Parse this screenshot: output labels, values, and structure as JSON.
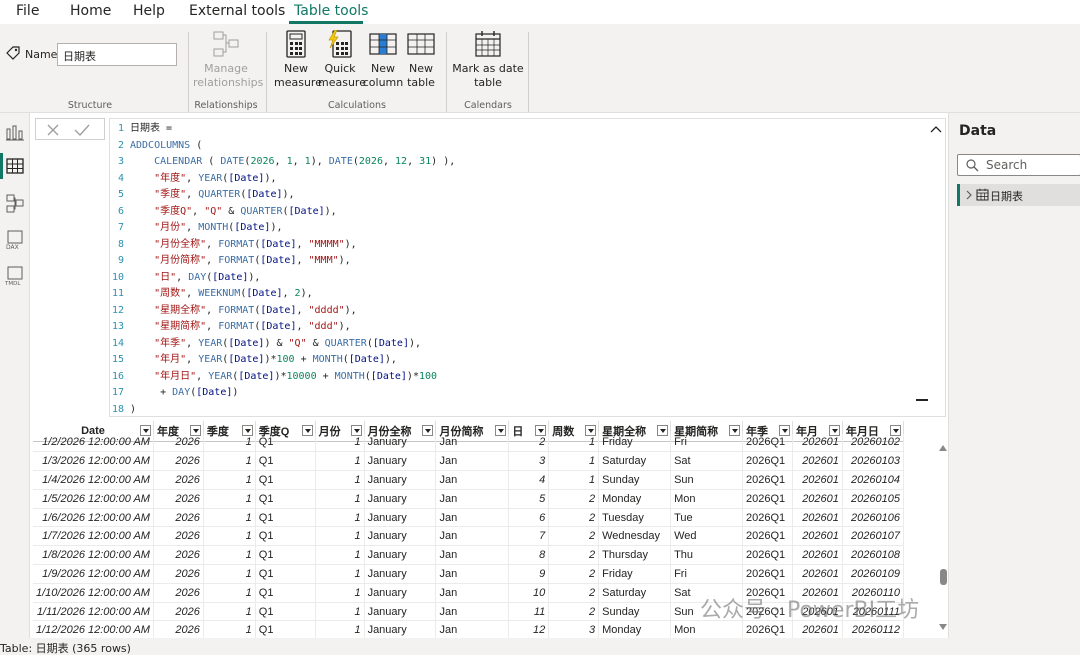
{
  "menu": {
    "file": "File",
    "home": "Home",
    "help": "Help",
    "external_tools": "External tools",
    "table_tools": "Table tools"
  },
  "ribbon": {
    "name_label": "Name",
    "name_value": "日期表",
    "structure_label": "Structure",
    "manage_relationships": "Manage relationships",
    "relationships_label": "Relationships",
    "new_measure": "New measure",
    "quick_measure": "Quick measure",
    "new_column": "New column",
    "new_table": "New table",
    "calculations_label": "Calculations",
    "mark_as_date_table": "Mark as date table",
    "calendars_label": "Calendars"
  },
  "editor": {
    "lines": [
      {
        "n": "1",
        "html": "日期表 ="
      },
      {
        "n": "2",
        "html": "<span class='kw'>ADDCOLUMNS</span> ("
      },
      {
        "n": "3",
        "html": "    <span class='kw'>CALENDAR</span> ( <span class='kw'>DATE</span>(<span class='num'>2026</span>, <span class='num'>1</span>, <span class='num'>1</span>), <span class='kw'>DATE</span>(<span class='num'>2026</span>, <span class='num'>12</span>, <span class='num'>31</span>) ),"
      },
      {
        "n": "4",
        "html": "    <span class='str'>\"年度\"</span>, <span class='kw'>YEAR</span>(<span class='col'>[Date]</span>),"
      },
      {
        "n": "5",
        "html": "    <span class='str'>\"季度\"</span>, <span class='kw'>QUARTER</span>(<span class='col'>[Date]</span>),"
      },
      {
        "n": "6",
        "html": "    <span class='str'>\"季度Q\"</span>, <span class='str'>\"Q\"</span> &amp; <span class='kw'>QUARTER</span>(<span class='col'>[Date]</span>),"
      },
      {
        "n": "7",
        "html": "    <span class='str'>\"月份\"</span>, <span class='kw'>MONTH</span>(<span class='col'>[Date]</span>),"
      },
      {
        "n": "8",
        "html": "    <span class='str'>\"月份全称\"</span>, <span class='kw'>FORMAT</span>(<span class='col'>[Date]</span>, <span class='str'>\"MMMM\"</span>),"
      },
      {
        "n": "9",
        "html": "    <span class='str'>\"月份简称\"</span>, <span class='kw'>FORMAT</span>(<span class='col'>[Date]</span>, <span class='str'>\"MMM\"</span>),"
      },
      {
        "n": "10",
        "html": "    <span class='str'>\"日\"</span>, <span class='kw'>DAY</span>(<span class='col'>[Date]</span>),"
      },
      {
        "n": "11",
        "html": "    <span class='str'>\"周数\"</span>, <span class='kw'>WEEKNUM</span>(<span class='col'>[Date]</span>, <span class='num'>2</span>),"
      },
      {
        "n": "12",
        "html": "    <span class='str'>\"星期全称\"</span>, <span class='kw'>FORMAT</span>(<span class='col'>[Date]</span>, <span class='str'>\"dddd\"</span>),"
      },
      {
        "n": "13",
        "html": "    <span class='str'>\"星期简称\"</span>, <span class='kw'>FORMAT</span>(<span class='col'>[Date]</span>, <span class='str'>\"ddd\"</span>),"
      },
      {
        "n": "14",
        "html": "    <span class='str'>\"年季\"</span>, <span class='kw'>YEAR</span>(<span class='col'>[Date]</span>) &amp; <span class='str'>\"Q\"</span> &amp; <span class='kw'>QUARTER</span>(<span class='col'>[Date]</span>),"
      },
      {
        "n": "15",
        "html": "    <span class='str'>\"年月\"</span>, <span class='kw'>YEAR</span>(<span class='col'>[Date]</span>)*<span class='num'>100</span> + <span class='kw'>MONTH</span>(<span class='col'>[Date]</span>),"
      },
      {
        "n": "16",
        "html": "    <span class='str'>\"年月日\"</span>, <span class='kw'>YEAR</span>(<span class='col'>[Date]</span>)*<span class='num'>10000</span> + <span class='kw'>MONTH</span>(<span class='col'>[Date]</span>)*<span class='num'>100</span>"
      },
      {
        "n": "17",
        "html": "     + <span class='kw'>DAY</span>(<span class='col'>[Date]</span>)"
      },
      {
        "n": "18",
        "html": ")"
      }
    ]
  },
  "table": {
    "columns": [
      "Date",
      "年度",
      "季度",
      "季度Q",
      "月份",
      "月份全称",
      "月份简称",
      "日",
      "周数",
      "星期全称",
      "星期简称",
      "年季",
      "年月",
      "年月日"
    ],
    "rows": [
      [
        "1/2/2026 12:00:00 AM",
        "2026",
        "1",
        "Q1",
        "1",
        "January",
        "Jan",
        "2",
        "1",
        "Friday",
        "Fri",
        "2026Q1",
        "202601",
        "20260102"
      ],
      [
        "1/3/2026 12:00:00 AM",
        "2026",
        "1",
        "Q1",
        "1",
        "January",
        "Jan",
        "3",
        "1",
        "Saturday",
        "Sat",
        "2026Q1",
        "202601",
        "20260103"
      ],
      [
        "1/4/2026 12:00:00 AM",
        "2026",
        "1",
        "Q1",
        "1",
        "January",
        "Jan",
        "4",
        "1",
        "Sunday",
        "Sun",
        "2026Q1",
        "202601",
        "20260104"
      ],
      [
        "1/5/2026 12:00:00 AM",
        "2026",
        "1",
        "Q1",
        "1",
        "January",
        "Jan",
        "5",
        "2",
        "Monday",
        "Mon",
        "2026Q1",
        "202601",
        "20260105"
      ],
      [
        "1/6/2026 12:00:00 AM",
        "2026",
        "1",
        "Q1",
        "1",
        "January",
        "Jan",
        "6",
        "2",
        "Tuesday",
        "Tue",
        "2026Q1",
        "202601",
        "20260106"
      ],
      [
        "1/7/2026 12:00:00 AM",
        "2026",
        "1",
        "Q1",
        "1",
        "January",
        "Jan",
        "7",
        "2",
        "Wednesday",
        "Wed",
        "2026Q1",
        "202601",
        "20260107"
      ],
      [
        "1/8/2026 12:00:00 AM",
        "2026",
        "1",
        "Q1",
        "1",
        "January",
        "Jan",
        "8",
        "2",
        "Thursday",
        "Thu",
        "2026Q1",
        "202601",
        "20260108"
      ],
      [
        "1/9/2026 12:00:00 AM",
        "2026",
        "1",
        "Q1",
        "1",
        "January",
        "Jan",
        "9",
        "2",
        "Friday",
        "Fri",
        "2026Q1",
        "202601",
        "20260109"
      ],
      [
        "1/10/2026 12:00:00 AM",
        "2026",
        "1",
        "Q1",
        "1",
        "January",
        "Jan",
        "10",
        "2",
        "Saturday",
        "Sat",
        "2026Q1",
        "202601",
        "20260110"
      ],
      [
        "1/11/2026 12:00:00 AM",
        "2026",
        "1",
        "Q1",
        "1",
        "January",
        "Jan",
        "11",
        "2",
        "Sunday",
        "Sun",
        "2026Q1",
        "202601",
        "20260111"
      ],
      [
        "1/12/2026 12:00:00 AM",
        "2026",
        "1",
        "Q1",
        "1",
        "January",
        "Jan",
        "12",
        "3",
        "Monday",
        "Mon",
        "2026Q1",
        "202601",
        "20260112"
      ]
    ]
  },
  "status": {
    "text": "Table: 日期表 (365 rows)"
  },
  "data_pane": {
    "title": "Data",
    "search_placeholder": "Search",
    "table_item": "日期表"
  },
  "watermark": "公众号 · PowerBI工坊",
  "colors": {
    "accent": "#117865"
  }
}
